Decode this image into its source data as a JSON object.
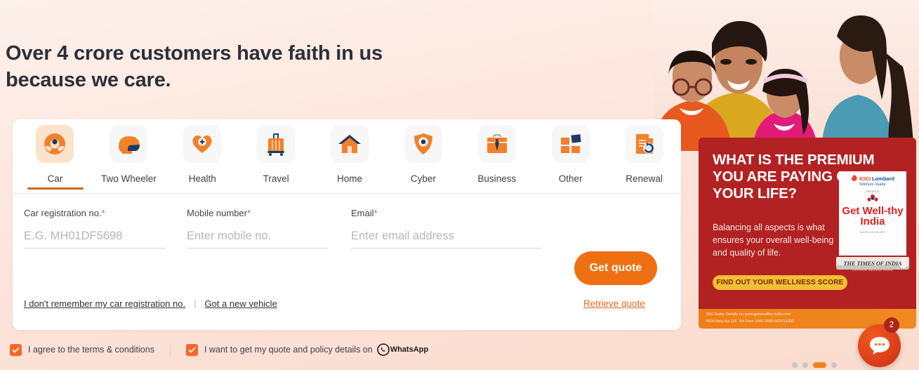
{
  "hero": {
    "headline": "Over 4 crore customers have faith in us because we care.",
    "photo_alt": "family-photo"
  },
  "tabs": [
    {
      "label": "Car",
      "icon": "steering-wheel-icon",
      "active": true
    },
    {
      "label": "Two Wheeler",
      "icon": "helmet-icon",
      "active": false
    },
    {
      "label": "Health",
      "icon": "heart-plus-icon",
      "active": false
    },
    {
      "label": "Travel",
      "icon": "suitcase-icon",
      "active": false
    },
    {
      "label": "Home",
      "icon": "house-icon",
      "active": false
    },
    {
      "label": "Cyber",
      "icon": "shield-eye-icon",
      "active": false
    },
    {
      "label": "Business",
      "icon": "briefcase-tie-icon",
      "active": false
    },
    {
      "label": "Other",
      "icon": "grid-squares-icon",
      "active": false
    },
    {
      "label": "Renewal",
      "icon": "document-refresh-icon",
      "active": false
    }
  ],
  "form": {
    "registration": {
      "label": "Car registration no.",
      "required_mark": "*",
      "placeholder": "E.G. MH01DF5698",
      "value": ""
    },
    "mobile": {
      "label": "Mobile number",
      "required_mark": "*",
      "placeholder": "Enter mobile no.",
      "value": ""
    },
    "email": {
      "label": "Email",
      "required_mark": "*",
      "placeholder": "Enter email address",
      "value": ""
    },
    "submit_label": "Get quote",
    "forgot_registration_link": "I don't remember my car registration no.",
    "links_separator": "|",
    "new_vehicle_link": "Got a new vehicle",
    "retrieve_quote_link": "Retrieve quote"
  },
  "consent": {
    "terms_label": "I agree to the terms & conditions",
    "whatsapp_label": "I want to get my quote and policy details on",
    "whatsapp_brand": "WhatsApp",
    "terms_checked": true,
    "whatsapp_checked": true
  },
  "ad": {
    "title": "WHAT IS THE PREMIUM YOU ARE PAYING ON YOUR LIFE?",
    "body": "Balancing all aspects is what ensures your overall well-being and quality of life.",
    "cta_label": "FIND OUT YOUR WELLNESS SCORE",
    "badge": {
      "brand": "ICICI",
      "brand2": "Lombard",
      "tagline": "Nibhaye Vaade",
      "presents": "PRESENTS",
      "main": "Get Well-thy India",
      "fine": "IN ASSOCIATION WITH"
    },
    "newspaper": "THE TIMES OF INDIA",
    "newspaper_sub": "CHANGE BEGINS HERE",
    "disclaimer_line1": "T&C Apply. Details on www.getwealthy-india.com",
    "disclaimer_line2": "IRDA Reg.No.115. Toll Free 1800 2666.ADV/11031"
  },
  "chat": {
    "badge_count": "2",
    "icon": "chat-bubble-icon"
  },
  "carousel": {
    "dots": [
      {
        "active": false
      },
      {
        "active": false
      },
      {
        "active": true
      },
      {
        "active": false
      }
    ]
  },
  "colors": {
    "accent_orange": "#ef7012",
    "ad_red": "#b22222",
    "cta_yellow": "#f0c033",
    "checkbox_orange": "#f2682a",
    "tab_underline": "#c96a1f"
  }
}
